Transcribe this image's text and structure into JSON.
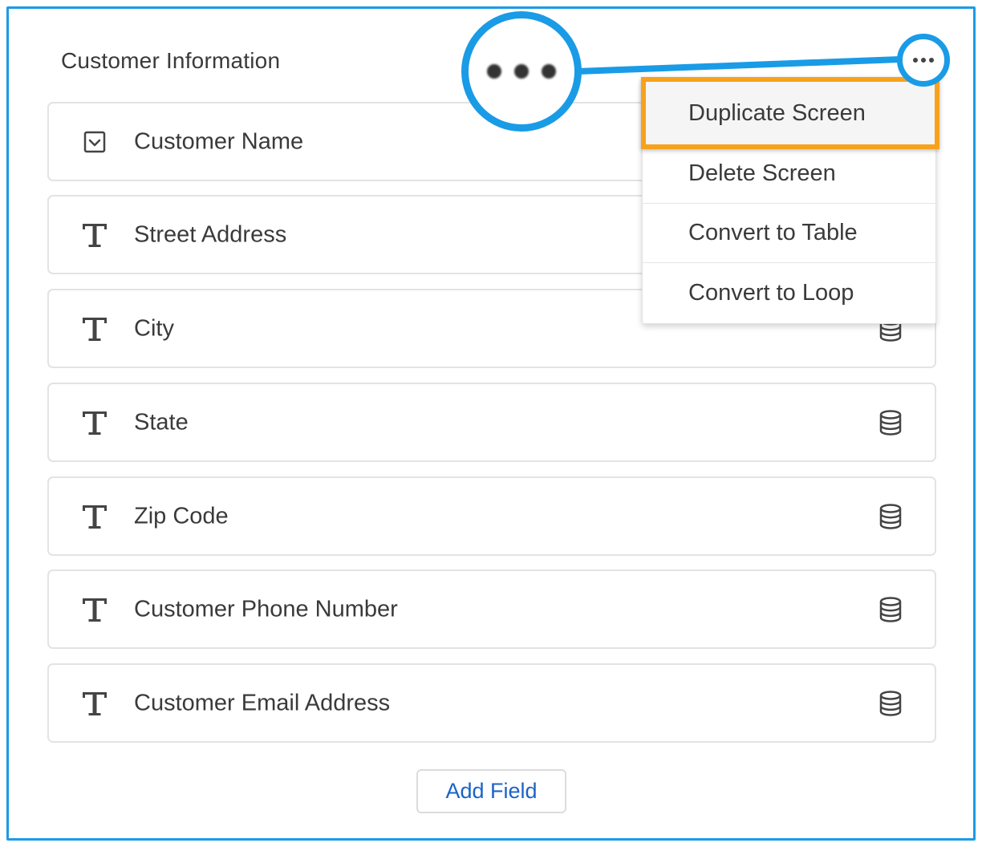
{
  "screen": {
    "title": "Customer Information"
  },
  "fields": [
    {
      "label": "Customer Name",
      "type_icon": "checkbox-icon",
      "db_icon": false
    },
    {
      "label": "Street Address",
      "type_icon": "text-type-icon",
      "db_icon": true
    },
    {
      "label": "City",
      "type_icon": "text-type-icon",
      "db_icon": true
    },
    {
      "label": "State",
      "type_icon": "text-type-icon",
      "db_icon": true
    },
    {
      "label": "Zip Code",
      "type_icon": "text-type-icon",
      "db_icon": true
    },
    {
      "label": "Customer Phone Number",
      "type_icon": "text-type-icon",
      "db_icon": true
    },
    {
      "label": "Customer Email Address",
      "type_icon": "text-type-icon",
      "db_icon": true
    }
  ],
  "add_field_label": "Add Field",
  "menu": {
    "items": [
      {
        "label": "Duplicate Screen",
        "highlighted": true
      },
      {
        "label": "Delete Screen"
      },
      {
        "label": "Convert to Table"
      },
      {
        "label": "Convert to Loop"
      }
    ]
  },
  "colors": {
    "accent_blue": "#1a9be6",
    "highlight_orange": "#f7a21b",
    "link_blue": "#1b63c6"
  }
}
